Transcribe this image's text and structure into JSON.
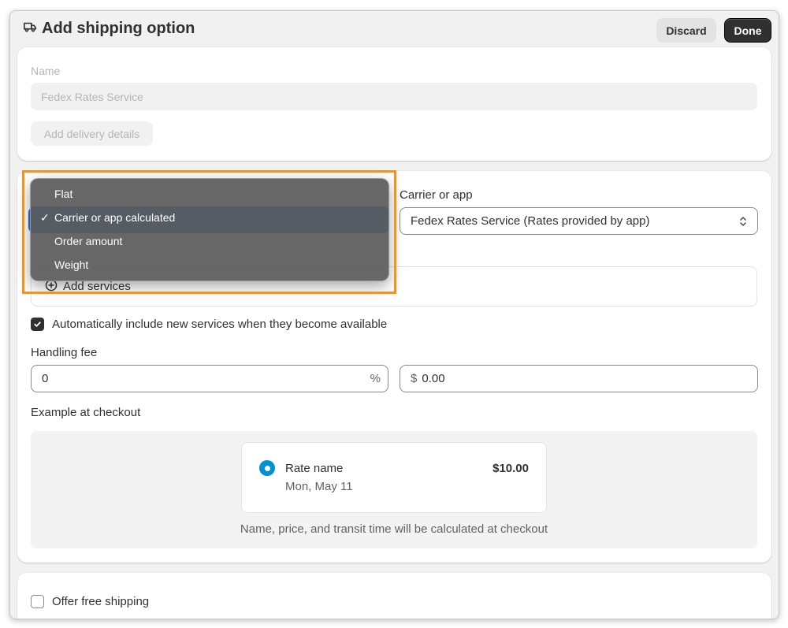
{
  "header": {
    "title": "Add shipping option",
    "icon": "truck-icon",
    "discard_label": "Discard",
    "done_label": "Done"
  },
  "name_section": {
    "label": "Name",
    "value": "Fedex Rates Service",
    "add_details_label": "Add delivery details"
  },
  "rate_section": {
    "carrier_label": "Carrier or app",
    "carrier_value": "Fedex Rates Service (Rates provided by app)",
    "add_services_label": "Add services",
    "auto_include_label": "Automatically include new services when they become available",
    "auto_include_checked": true,
    "handling_fee_label": "Handling fee",
    "handling_percent_value": "0",
    "handling_percent_suffix": "%",
    "handling_amount_prefix": "$",
    "handling_amount_value": "0.00",
    "example_label": "Example at checkout",
    "example": {
      "rate_name": "Rate name",
      "rate_date": "Mon, May 11",
      "rate_price": "$10.00",
      "note": "Name, price, and transit time will be calculated at checkout"
    }
  },
  "free_shipping": {
    "label": "Offer free shipping",
    "checked": false
  },
  "rate_type_dropdown": {
    "options": [
      "Flat",
      "Carrier or app calculated",
      "Order amount",
      "Weight"
    ],
    "selected": "Carrier or app calculated",
    "check_glyph": "✓"
  },
  "colors": {
    "accent_blue": "#0091d5",
    "highlight_orange": "#f0941e",
    "primary_button": "#303030"
  }
}
